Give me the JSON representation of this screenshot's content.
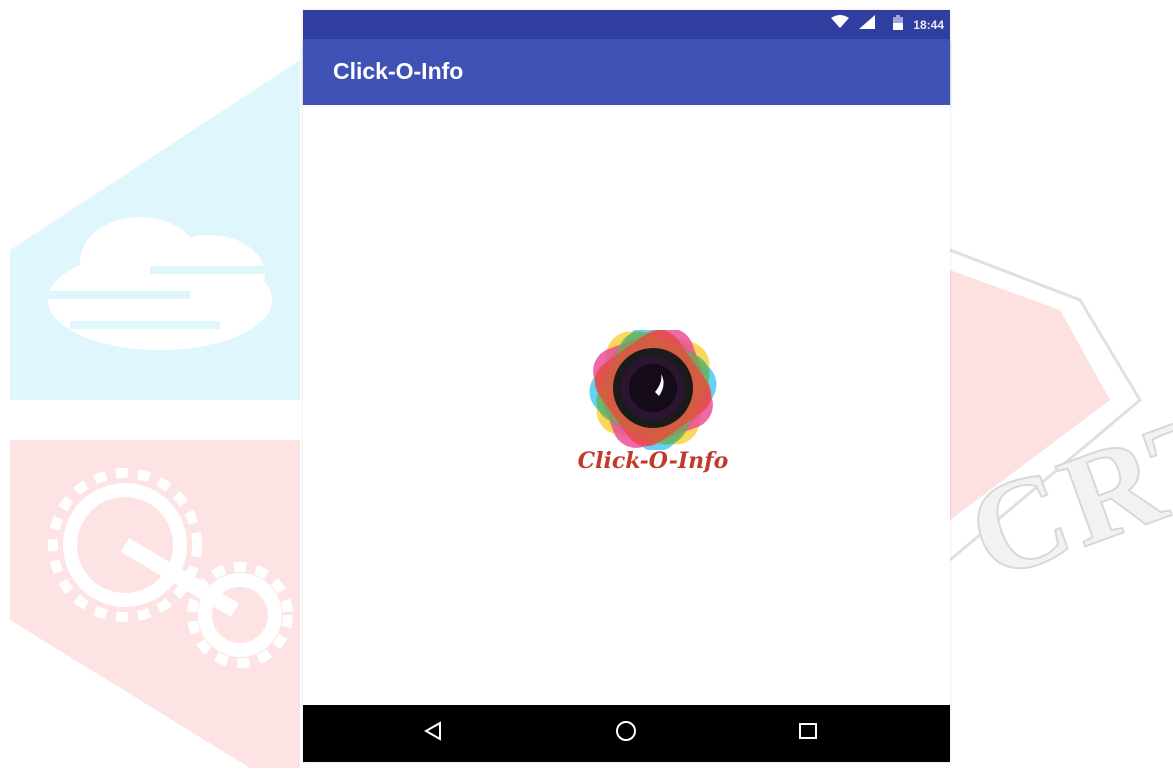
{
  "status_bar": {
    "time": "18:44",
    "icons": [
      "wifi-icon",
      "signal-icon",
      "battery-icon"
    ]
  },
  "app_bar": {
    "title": "Click-O-Info"
  },
  "splash": {
    "logo_text": "Click-O-Info",
    "logo_icon": "camera-lens-flower-logo"
  },
  "nav_bar": {
    "buttons": [
      "back-icon",
      "home-icon",
      "recents-icon"
    ]
  },
  "watermark": {
    "text": "CRT"
  },
  "colors": {
    "status_bar": "#303f9f",
    "app_bar": "#3f51b5",
    "nav_bar": "#000000",
    "watermark_cyan": "#dff7fc",
    "watermark_pink": "#fde3e3"
  }
}
